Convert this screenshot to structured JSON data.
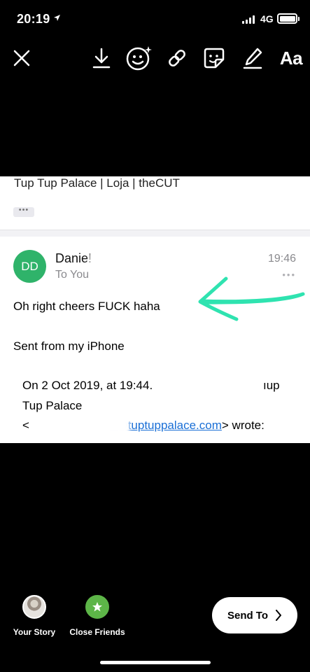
{
  "status_bar": {
    "time": "20:19",
    "network": "4G"
  },
  "toolbar": {
    "text_tool_label": "Aa"
  },
  "email": {
    "previous_subject": "Tup Tup Palace | Loja | theCUT",
    "more_chip": "•••",
    "avatar_initials": "DD",
    "sender_name": "Danie!",
    "recipient": "To You",
    "time": "19:46",
    "more_dots": "•••",
    "body_line_1": "Oh right cheers FUCK haha",
    "body_line_2": "Sent from my iPhone",
    "quote_line_1": "On 2 Oct 2019, at 19:44.",
    "quote_line_1_end": "ıup",
    "quote_line_2": "Tup Palace",
    "quote_line_3_start": "<",
    "quote_link": "s@tuptuppalace.com",
    "quote_line_3_end": "> wrote:"
  },
  "share": {
    "your_story": "Your Story",
    "close_friends": "Close Friends",
    "send_to": "Send To"
  },
  "colors": {
    "avatar_green": "#2fb36a",
    "arrow_color": "#2fe3b0",
    "close_friends_green": "#5db548",
    "link_blue": "#1a6fd6"
  }
}
